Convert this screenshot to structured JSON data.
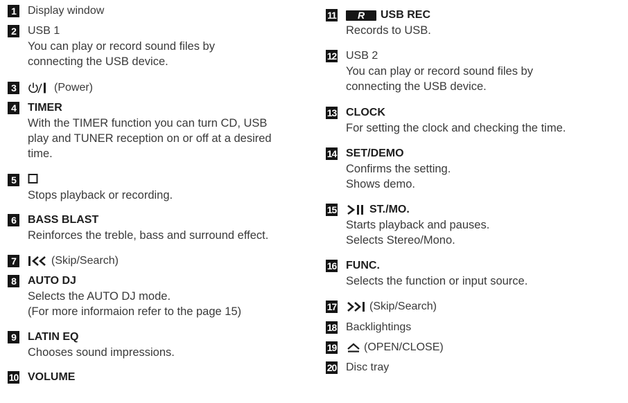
{
  "left": {
    "items": [
      {
        "num": "1",
        "label": "Display window"
      },
      {
        "num": "2",
        "label": "USB 1",
        "desc": [
          "You can play or record sound files by",
          "connecting the USB device."
        ]
      },
      {
        "num": "3",
        "symbol": "power-icon",
        "label": "(Power)"
      },
      {
        "num": "4",
        "title": "TIMER",
        "desc": [
          "With the TIMER function you can turn CD, USB",
          "play and TUNER reception on or off at a desired",
          "time."
        ]
      },
      {
        "num": "5",
        "symbol": "stop-icon",
        "desc": [
          "Stops playback or recording."
        ]
      },
      {
        "num": "6",
        "title": "BASS BLAST",
        "desc": [
          "Reinforces the treble, bass and surround effect."
        ]
      },
      {
        "num": "7",
        "symbol": "skip-back-icon",
        "label": "(Skip/Search)"
      },
      {
        "num": "8",
        "title": "AUTO DJ",
        "desc": [
          "Selects the AUTO DJ mode.",
          "(For more informaion refer to the page 15)"
        ]
      },
      {
        "num": "9",
        "title": "LATIN EQ",
        "desc": [
          "Chooses sound impressions."
        ]
      },
      {
        "num": "10",
        "title": "VOLUME"
      }
    ]
  },
  "right": {
    "items": [
      {
        "num": "11",
        "badge": "R",
        "title": "USB REC",
        "desc": [
          "Records to USB."
        ]
      },
      {
        "num": "12",
        "label": "USB 2",
        "desc": [
          "You can play or record sound files by",
          "connecting the USB device."
        ]
      },
      {
        "num": "13",
        "title": "CLOCK",
        "desc": [
          "For setting the clock and checking the time."
        ]
      },
      {
        "num": "14",
        "title": "SET/DEMO",
        "desc": [
          "Confirms the setting.",
          "Shows demo."
        ]
      },
      {
        "num": "15",
        "symbol": "play-pause-icon",
        "title": "ST./MO.",
        "desc": [
          "Starts playback and pauses.",
          "Selects Stereo/Mono."
        ]
      },
      {
        "num": "16",
        "title": "FUNC.",
        "desc": [
          "Selects the function or input source."
        ]
      },
      {
        "num": "17",
        "symbol": "skip-forward-icon",
        "label": "(Skip/Search)"
      },
      {
        "num": "18",
        "label": "Backlightings"
      },
      {
        "num": "19",
        "symbol": "eject-icon",
        "label": "(OPEN/CLOSE)"
      },
      {
        "num": "20",
        "label": "Disc tray"
      }
    ]
  }
}
